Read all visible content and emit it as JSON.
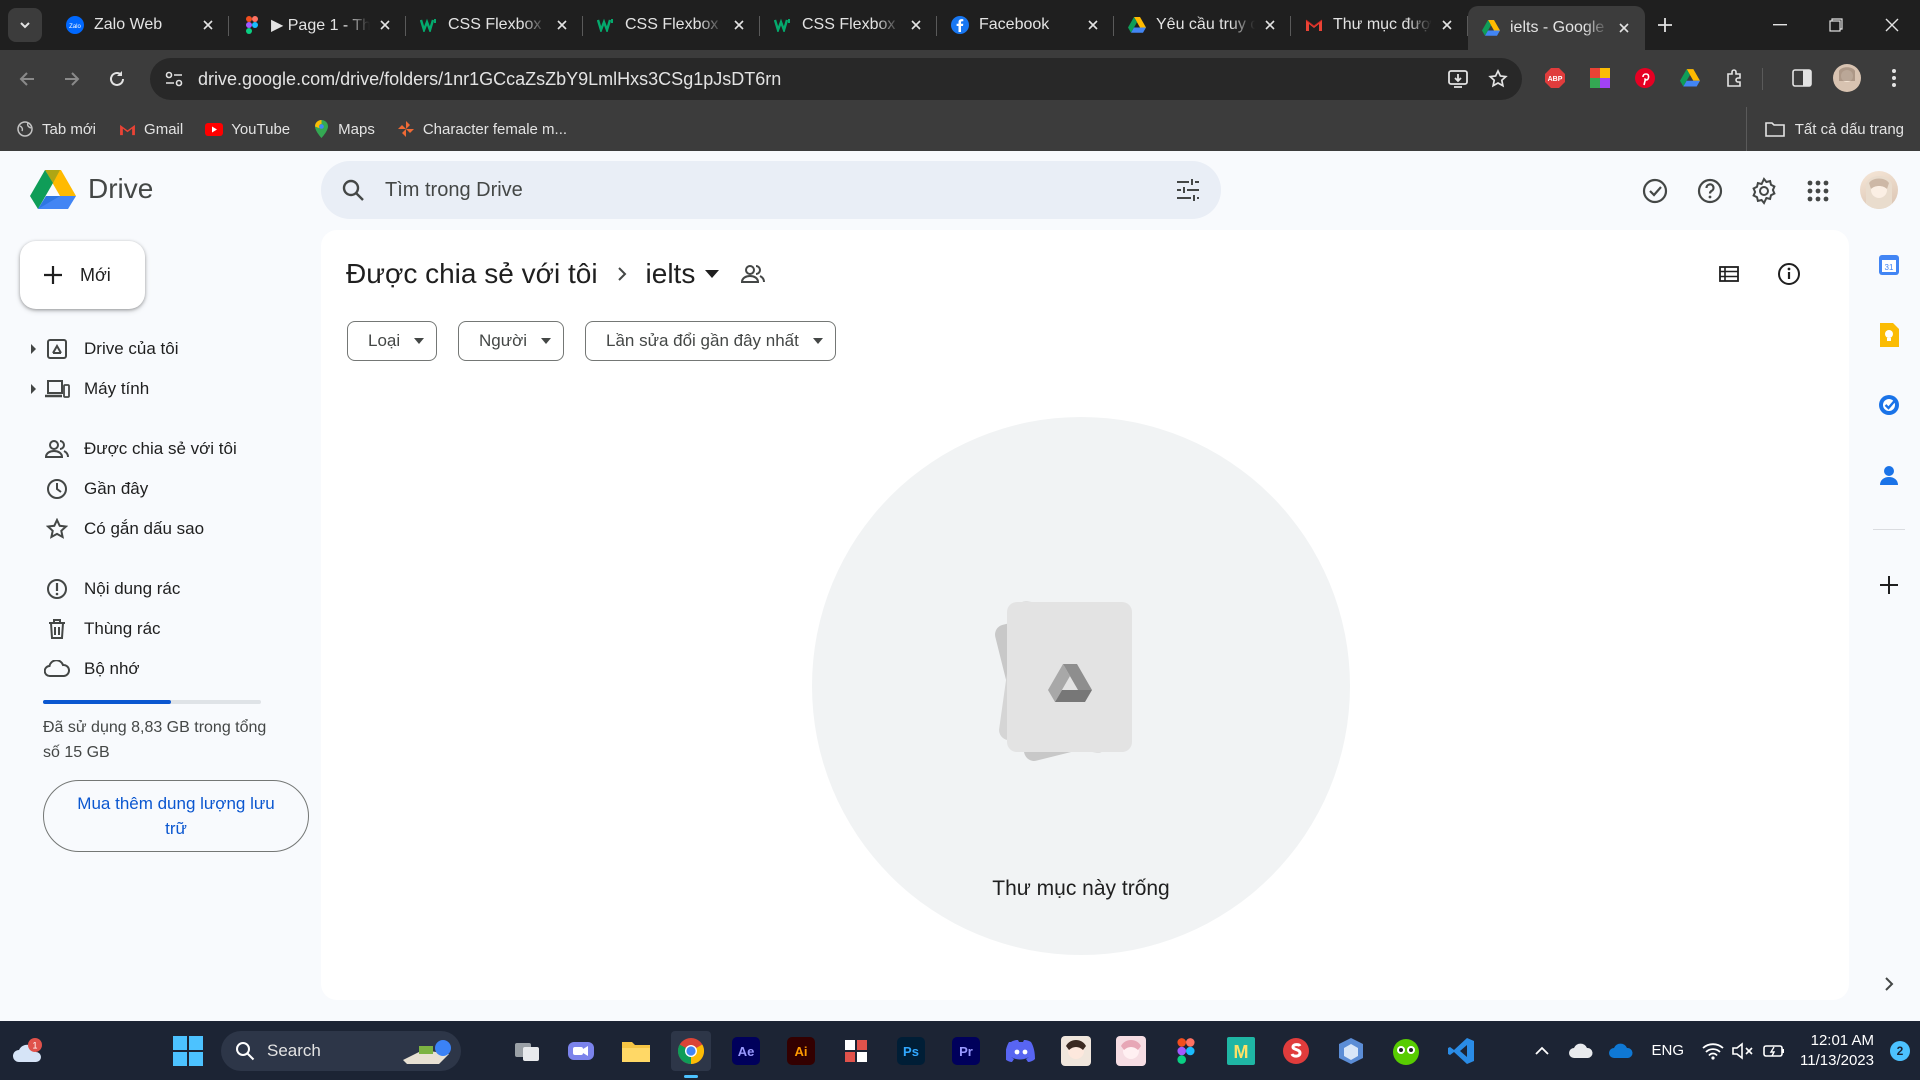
{
  "tabs": [
    {
      "title": "Zalo Web",
      "icon": "zalo-icon",
      "active": false
    },
    {
      "title": "▶ Page 1 - Th",
      "icon": "figma-icon",
      "active": false
    },
    {
      "title": "CSS Flexbox (",
      "icon": "w3schools-icon",
      "active": false
    },
    {
      "title": "CSS Flexbox (",
      "icon": "w3schools-icon",
      "active": false
    },
    {
      "title": "CSS Flexbox I",
      "icon": "w3schools-icon",
      "active": false
    },
    {
      "title": "Facebook",
      "icon": "facebook-icon",
      "active": false
    },
    {
      "title": "Yêu cầu truy c",
      "icon": "google-drive-icon",
      "active": false
    },
    {
      "title": "Thư mục đượ",
      "icon": "gmail-icon",
      "active": false
    },
    {
      "title": "ielts - Google",
      "icon": "google-drive-icon",
      "active": true
    }
  ],
  "address": {
    "url": "drive.google.com/drive/folders/1nr1GCcaZsZbY9LmlHxs3CSg1pJsDT6rn"
  },
  "extensions": {
    "abp_label": "ABP"
  },
  "bookmarks": [
    {
      "label": "Tab mới",
      "icon": "globe-icon"
    },
    {
      "label": "Gmail",
      "icon": "gmail-icon"
    },
    {
      "label": "YouTube",
      "icon": "youtube-icon"
    },
    {
      "label": "Maps",
      "icon": "maps-icon"
    },
    {
      "label": "Character female m...",
      "icon": "pinwheel-icon"
    }
  ],
  "all_bookmarks_label": "Tất cả dấu trang",
  "drive": {
    "logo_text": "Drive",
    "search_placeholder": "Tìm trong Drive",
    "new_label": "Mới",
    "nav": [
      {
        "label": "Drive của tôi",
        "icon": "my-drive-icon"
      },
      {
        "label": "Máy tính",
        "icon": "computers-icon"
      },
      {
        "label": "Được chia sẻ với tôi",
        "icon": "shared-icon"
      },
      {
        "label": "Gần đây",
        "icon": "recent-icon"
      },
      {
        "label": "Có gắn dấu sao",
        "icon": "star-icon"
      },
      {
        "label": "Nội dung rác",
        "icon": "spam-icon"
      },
      {
        "label": "Thùng rác",
        "icon": "trash-icon"
      },
      {
        "label": "Bộ nhớ",
        "icon": "cloud-icon"
      }
    ],
    "storage": {
      "used_fraction": 0.589,
      "text": "Đã sử dụng 8,83 GB trong tổng số 15 GB"
    },
    "buy_storage_label": "Mua thêm dung lượng lưu trữ",
    "breadcrumb": {
      "parent": "Được chia sẻ với tôi",
      "current": "ielts"
    },
    "filters": [
      "Loại",
      "Người",
      "Lần sửa đổi gần đây nhất"
    ],
    "empty_text": "Thư mục này trống",
    "brand_blue": "#0b57d0"
  },
  "taskbar": {
    "search_label": "Search",
    "notification_count": "1",
    "tray": {
      "language": "ENG",
      "time": "12:01 AM",
      "date": "11/13/2023",
      "badge": "2"
    },
    "apps": [
      {
        "name": "ae",
        "label": "Ae"
      },
      {
        "name": "ai",
        "label": "Ai"
      },
      {
        "name": "ps",
        "label": "Ps"
      },
      {
        "name": "pr",
        "label": "Pr"
      },
      {
        "name": "m",
        "label": "M"
      }
    ]
  }
}
